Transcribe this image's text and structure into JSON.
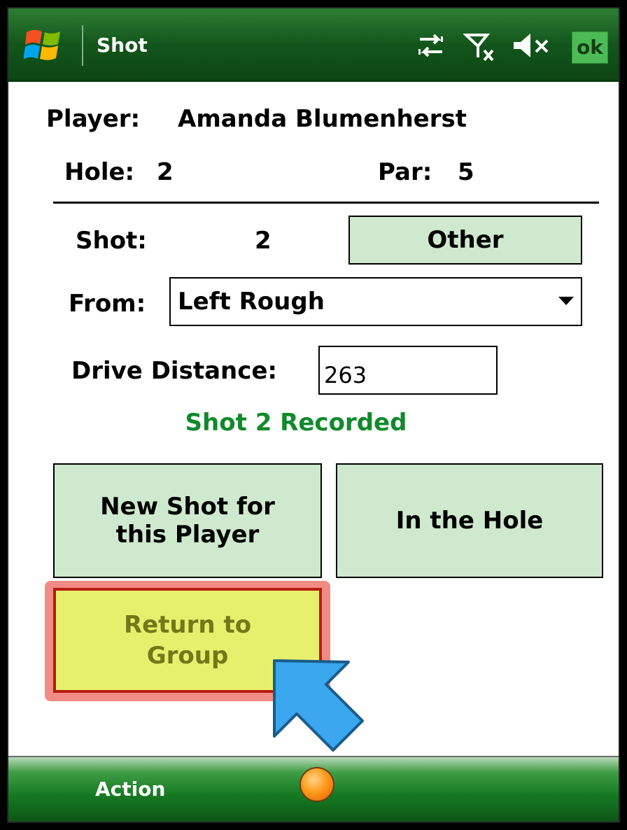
{
  "titlebar": {
    "app_title": "Shot",
    "ok_label": "ok",
    "icons": [
      "windows-start-icon",
      "sync-arrows-icon",
      "signal-off-icon",
      "volume-muted-icon"
    ]
  },
  "header": {
    "player_label": "Player:",
    "player_name": "Amanda Blumenherst",
    "hole_label": "Hole:",
    "hole_value": "2",
    "par_label": "Par:",
    "par_value": "5"
  },
  "form": {
    "shot_label": "Shot:",
    "shot_value": "2",
    "shot_type_button": "Other",
    "from_label": "From:",
    "from_value": "Left Rough",
    "drive_distance_label": "Drive Distance:",
    "drive_distance_value": "263"
  },
  "status_text": "Shot 2 Recorded",
  "buttons": {
    "new_shot": [
      "New Shot for",
      "this Player"
    ],
    "in_the_hole": "In the Hole",
    "return_to_group": [
      "Return to",
      "Group"
    ]
  },
  "menubar": {
    "left_softkey": "Action"
  },
  "colors": {
    "titlebar_green": "#13561c",
    "button_green": "#cfe9cf",
    "status_green": "#118a2b",
    "highlight_yellow": "#e7f06c",
    "highlight_border": "#b51c10",
    "pointer_blue": "#3aa7ee"
  }
}
